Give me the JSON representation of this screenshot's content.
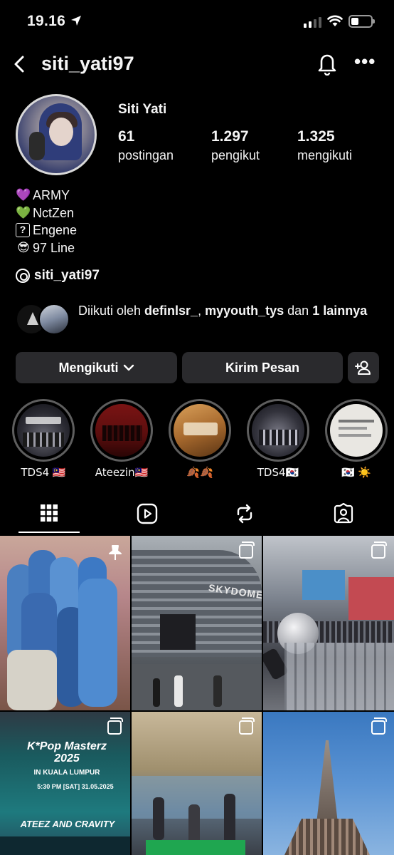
{
  "status_bar": {
    "time": "19.16",
    "location_icon": "location-arrow-icon",
    "battery_level": 0.35
  },
  "header": {
    "username": "siti_yati97",
    "back_icon": "chevron-left-icon",
    "notifications_icon": "bell-icon",
    "more_icon": "more-horizontal-icon",
    "more_text": "•••"
  },
  "profile": {
    "display_name": "Siti Yati",
    "stats": [
      {
        "value": "61",
        "label": "postingan"
      },
      {
        "value": "1.297",
        "label": "pengikut"
      },
      {
        "value": "1.325",
        "label": "mengikuti"
      }
    ],
    "bio": [
      {
        "emoji": "💜",
        "text": "ARMY"
      },
      {
        "emoji": "💚",
        "text": "NctZen"
      },
      {
        "emoji": "?",
        "text": "Engene"
      },
      {
        "emoji": "😎",
        "text": "97 Line"
      }
    ],
    "threads_handle": "siti_yati97",
    "followed_by": {
      "prefix": "Diikuti oleh ",
      "user1": "definlsr_",
      "separator": ", ",
      "user2": "myyouth_tys",
      "middle": " dan ",
      "suffix": "1 lainnya"
    }
  },
  "actions": {
    "following_label": "Mengikuti",
    "message_label": "Kirim Pesan",
    "add_user_icon": "add-user-icon"
  },
  "highlights": [
    {
      "label": "TDS4 🇲🇾"
    },
    {
      "label": "Ateezin🇲🇾"
    },
    {
      "label": "🍂🍂"
    },
    {
      "label": "TDS4🇰🇷"
    },
    {
      "label": "🇰🇷 ☀️"
    }
  ],
  "tabs": [
    "grid-icon",
    "reels-icon",
    "reposts-icon",
    "tagged-icon"
  ],
  "grid_overlays": {
    "kpop_poster_title": "K*Pop Masterz 2025",
    "kpop_poster_sub": "IN KUALA LUMPUR",
    "kpop_poster_date": "5:30 PM [SAT] 31.05.2025",
    "kpop_poster_bottom": "ATEEZ AND CRAVITY",
    "dome_sign": "SKYDOME"
  }
}
